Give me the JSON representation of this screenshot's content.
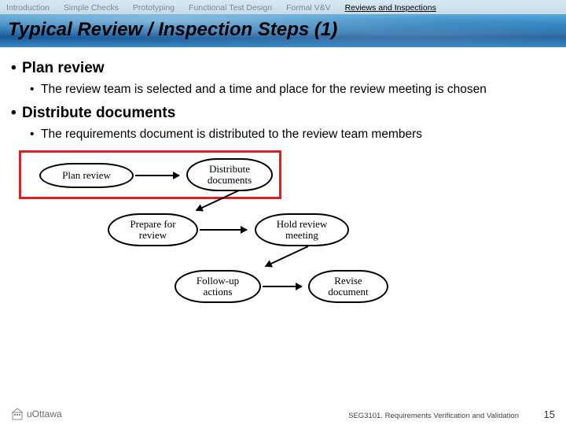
{
  "nav": {
    "items": [
      "Introduction",
      "Simple Checks",
      "Prototyping",
      "Functional Test Design",
      "Formal V&V",
      "Reviews and Inspections"
    ],
    "active_index": 5
  },
  "title": "Typical Review / Inspection Steps (1)",
  "bullets": [
    {
      "heading": "Plan review",
      "sub": "The review team is selected and a time and place for the review meeting is chosen"
    },
    {
      "heading": "Distribute documents",
      "sub": "The requirements document is distributed to the review team members"
    }
  ],
  "diagram": {
    "nodes": [
      {
        "label": "Plan review"
      },
      {
        "label": "Distribute\ndocuments"
      },
      {
        "label": "Prepare for\nreview"
      },
      {
        "label": "Hold review\nmeeting"
      },
      {
        "label": "Follow-up\nactions"
      },
      {
        "label": "Revise\ndocument"
      }
    ]
  },
  "footer": {
    "org": "uOttawa",
    "course": "SEG3101.  Requirements Verification and Validation",
    "page": "15"
  }
}
